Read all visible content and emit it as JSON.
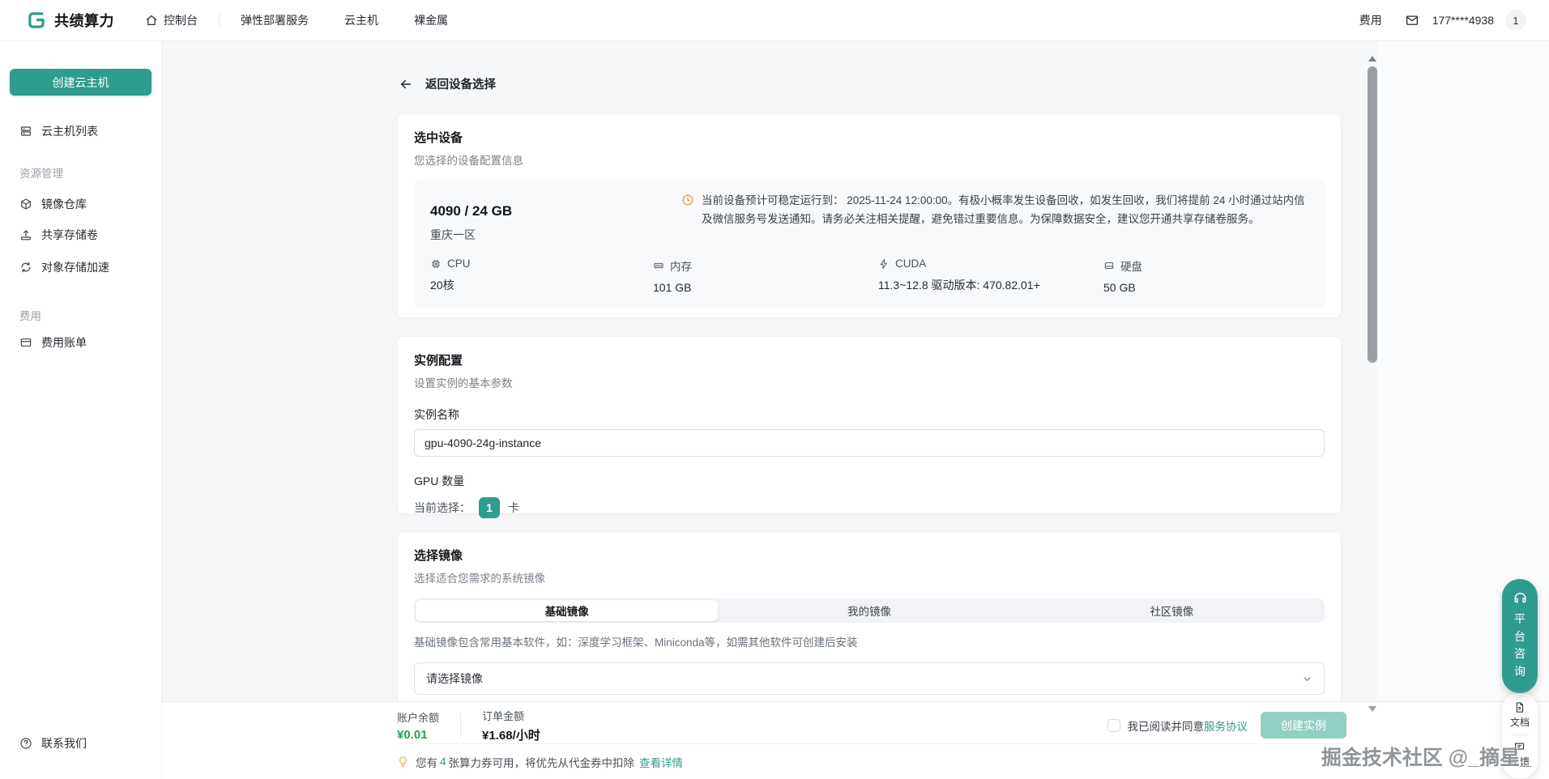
{
  "navbar": {
    "brand": "共绩算力",
    "items": {
      "console": "控制台",
      "elastic": "弹性部署服务",
      "cloud_host": "云主机",
      "bare_metal": "裸金属"
    },
    "right": {
      "billing": "费用",
      "phone": "177****4938",
      "badge": "1"
    }
  },
  "sidebar": {
    "create_button": "创建云主机",
    "host_list": "云主机列表",
    "sections": [
      {
        "title": "资源管理",
        "items": [
          "镜像仓库",
          "共享存储卷",
          "对象存储加速"
        ]
      },
      {
        "title": "费用",
        "items": [
          "费用账单"
        ]
      }
    ],
    "contact": "联系我们"
  },
  "main": {
    "back": "返回设备选择",
    "device_card": {
      "title": "选中设备",
      "subtitle": "您选择的设备配置信息",
      "gpu": "4090 / 24 GB",
      "region": "重庆一区",
      "notice": "当前设备预计可稳定运行到： 2025-11-24 12:00:00。有极小概率发生设备回收，如发生回收，我们将提前 24 小时通过站内信及微信服务号发送通知。请务必关注相关提醒，避免错过重要信息。为保障数据安全，建议您开通共享存储卷服务。",
      "specs": [
        {
          "icon": "cpu-icon",
          "label": "CPU",
          "value": "20核"
        },
        {
          "icon": "memory-icon",
          "label": "内存",
          "value": "101 GB"
        },
        {
          "icon": "cuda-icon",
          "label": "CUDA",
          "value": "11.3~12.8 驱动版本: 470.82.01+"
        },
        {
          "icon": "disk-icon",
          "label": "硬盘",
          "value": "50 GB"
        }
      ]
    },
    "instance_card": {
      "title": "实例配置",
      "subtitle": "设置实例的基本参数",
      "name_label": "实例名称",
      "name_value": "gpu-4090-24g-instance",
      "gpu_count_label": "GPU 数量",
      "current_label": "当前选择：",
      "current_value": "1",
      "unit": "卡"
    },
    "image_card": {
      "title": "选择镜像",
      "subtitle": "选择适合您需求的系统镜像",
      "tabs": [
        "基础镜像",
        "我的镜像",
        "社区镜像"
      ],
      "desc": "基础镜像包含常用基本软件，如：深度学习框架、Miniconda等，如需其他软件可创建后安装",
      "select_placeholder": "请选择镜像"
    }
  },
  "footer": {
    "balance_label": "账户余额",
    "balance_value": "¥0.01",
    "order_label": "订单金额",
    "order_value": "¥1.68/小时",
    "agree_prefix": "我已阅读并同意",
    "agreement_link": "服务协议",
    "create_button": "创建实例",
    "coupon_prefix": "您有",
    "coupon_count": "4",
    "coupon_suffix": "张算力券可用，将优先从代金券中扣除",
    "coupon_link": "查看详情"
  },
  "floating": {
    "consult": "平台咨询",
    "doc": "文档",
    "feedback": "反馈"
  },
  "watermark": "掘金技术社区 @_摘星_",
  "colors": {
    "primary": "#2f9d8d",
    "balance_green": "#21a355",
    "warning": "#eba03c"
  }
}
